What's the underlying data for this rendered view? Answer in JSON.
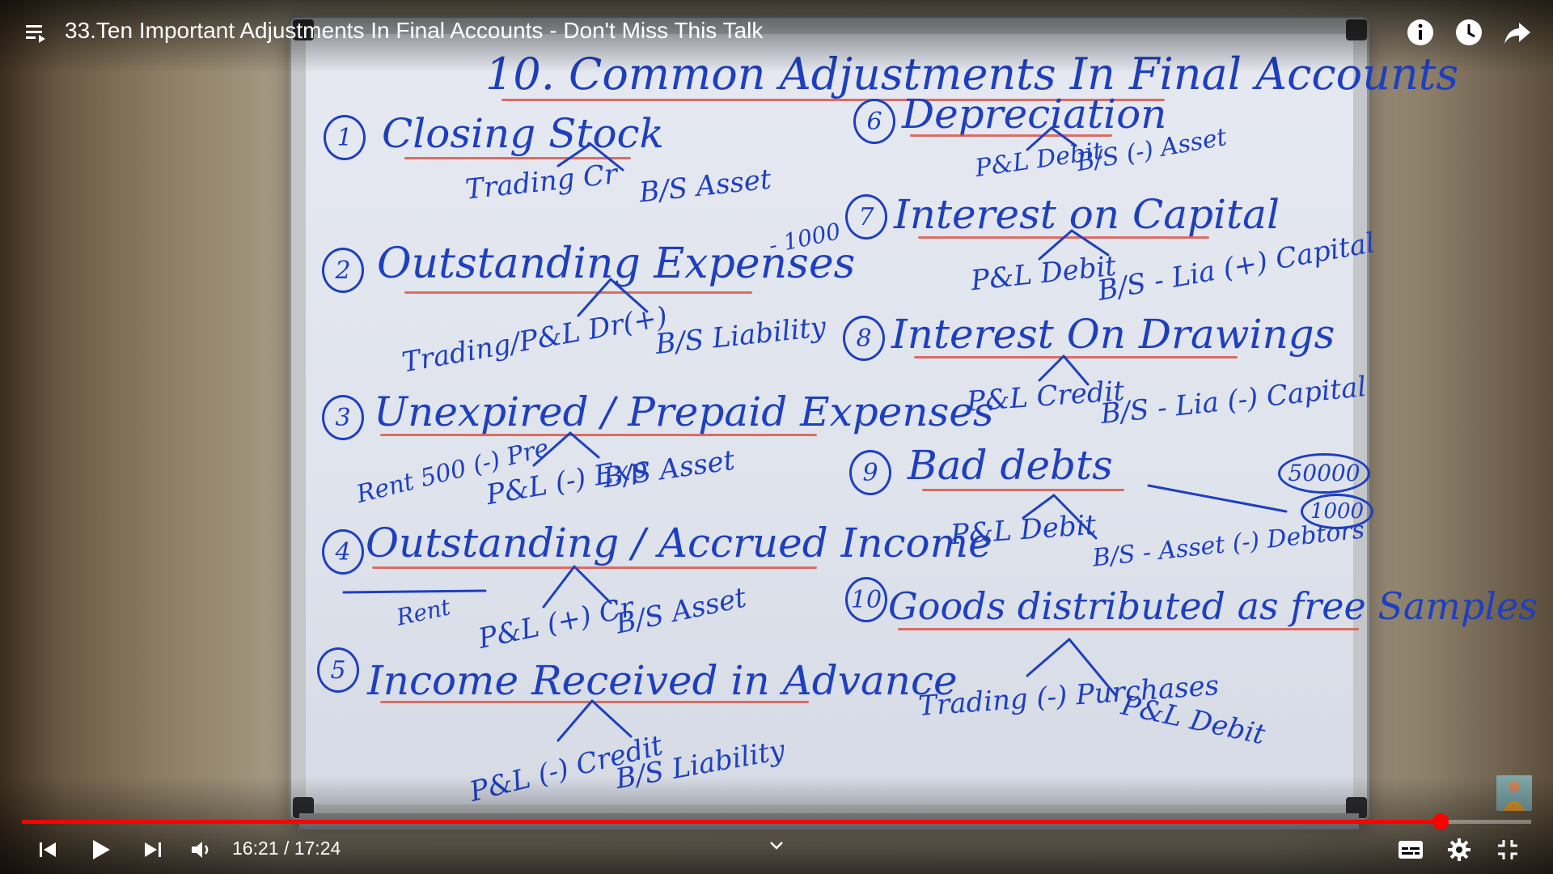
{
  "video": {
    "title": "33.Ten Important Adjustments In Final Accounts - Don't Miss This Talk",
    "time_display": "16:21 / 17:24",
    "current_time": "16:21",
    "duration": "17:24",
    "progress_fraction": 0.94,
    "accent_color": "#ff0000"
  },
  "board": {
    "heading": "10. Common Adjustments In Final Accounts",
    "items": [
      {
        "num": "1",
        "title": "Closing Stock",
        "left": "Trading Cr",
        "right": "B/S Asset"
      },
      {
        "num": "2",
        "title": "Outstanding Expenses",
        "note": "- 1000",
        "left": "Trading/P&L Dr(+)",
        "right": "B/S Liability"
      },
      {
        "num": "3",
        "title": "Unexpired / Prepaid Expenses",
        "aside": "Rent 500 (-) Pre",
        "left": "P&L (-) Exp",
        "right": "B/S Asset"
      },
      {
        "num": "4",
        "title": "Outstanding / Accrued Income",
        "aside": "Rent",
        "left": "P&L (+) Cr",
        "right": "B/S Asset"
      },
      {
        "num": "5",
        "title": "Income Received in Advance",
        "left": "P&L (-) Credit",
        "right": "B/S Liability"
      },
      {
        "num": "6",
        "title": "Depreciation",
        "left": "P&L Debit",
        "right": "B/S (-) Asset"
      },
      {
        "num": "7",
        "title": "Interest on Capital",
        "left": "P&L Debit",
        "right": "B/S - Lia (+) Capital"
      },
      {
        "num": "8",
        "title": "Interest On Drawings",
        "left": "P&L Credit",
        "right": "B/S - Lia (-) Capital"
      },
      {
        "num": "9",
        "title": "Bad debts",
        "left": "P&L Debit",
        "right": "B/S - Asset (-) Debtors"
      },
      {
        "num": "10",
        "title": "Goods distributed as free Samples",
        "left": "Trading (-) Purchases",
        "right": "P&L Debit"
      }
    ],
    "circled_notes": [
      "50000",
      "1000"
    ]
  },
  "icons": {
    "playlist": "playlist-icon",
    "info": "info-icon",
    "watch_later": "clock-icon",
    "share": "share-icon",
    "prev": "previous-icon",
    "play": "play-icon",
    "next": "next-icon",
    "volume": "volume-icon",
    "captions": "captions-icon",
    "settings": "gear-icon",
    "exit_fullscreen": "exit-fullscreen-icon",
    "chevron": "chevron-down-icon"
  }
}
